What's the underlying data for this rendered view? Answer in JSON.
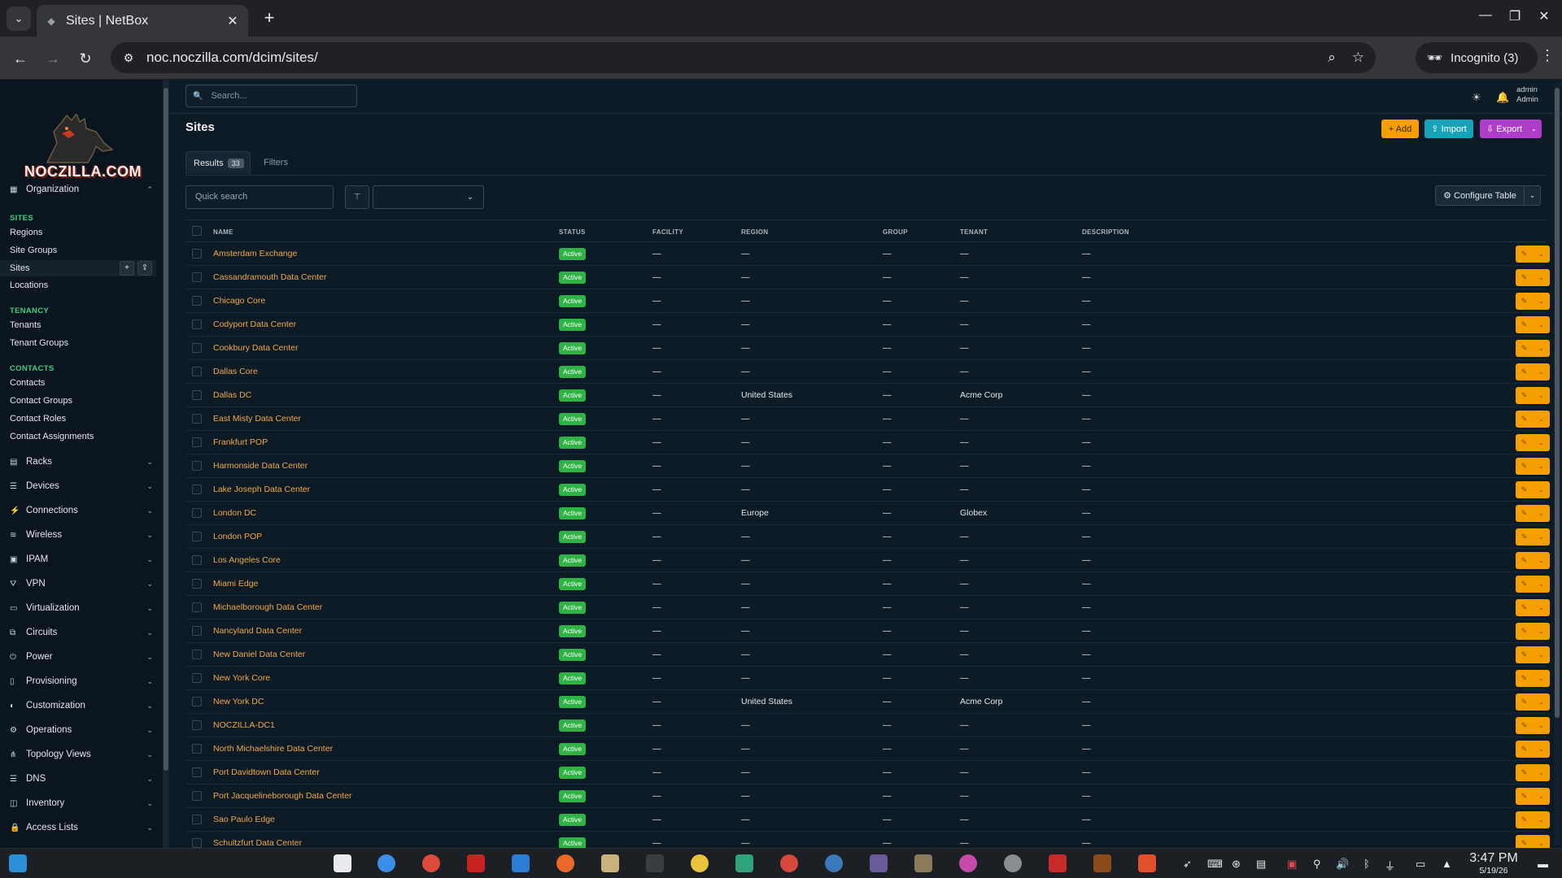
{
  "browser": {
    "tab_title": "Sites | NetBox",
    "url": "noc.noczilla.com/dcim/sites/",
    "incognito_label": "Incognito (3)"
  },
  "logo_text": "NOCZILLA.COM",
  "sidebar": {
    "organization": "Organization",
    "sections": {
      "sites": "SITES",
      "tenancy": "TENANCY",
      "contacts": "CONTACTS"
    },
    "site_items": [
      "Regions",
      "Site Groups",
      "Sites",
      "Locations"
    ],
    "tenancy_items": [
      "Tenants",
      "Tenant Groups"
    ],
    "contact_items": [
      "Contacts",
      "Contact Groups",
      "Contact Roles",
      "Contact Assignments"
    ],
    "menus": [
      "Racks",
      "Devices",
      "Connections",
      "Wireless",
      "IPAM",
      "VPN",
      "Virtualization",
      "Circuits",
      "Power",
      "Provisioning",
      "Customization",
      "Operations",
      "Topology Views",
      "DNS",
      "Inventory",
      "Access Lists"
    ]
  },
  "header": {
    "search_placeholder": "Search...",
    "user_name": "admin",
    "user_role": "Admin"
  },
  "page": {
    "title": "Sites",
    "add_label": "+ Add",
    "import_label": "⇪ Import",
    "export_label": "⇩ Export",
    "tab_results": "Results",
    "results_count": "33",
    "tab_filters": "Filters",
    "quick_search_placeholder": "Quick search",
    "configure_table": "⚙ Configure Table"
  },
  "table": {
    "columns": [
      "NAME",
      "STATUS",
      "FACILITY",
      "REGION",
      "GROUP",
      "TENANT",
      "DESCRIPTION"
    ],
    "rows": [
      {
        "name": "Amsterdam Exchange",
        "status": "Active",
        "facility": "—",
        "region": "—",
        "group": "—",
        "tenant": "—",
        "description": "—"
      },
      {
        "name": "Cassandramouth Data Center",
        "status": "Active",
        "facility": "—",
        "region": "—",
        "group": "—",
        "tenant": "—",
        "description": "—"
      },
      {
        "name": "Chicago Core",
        "status": "Active",
        "facility": "—",
        "region": "—",
        "group": "—",
        "tenant": "—",
        "description": "—"
      },
      {
        "name": "Codyport Data Center",
        "status": "Active",
        "facility": "—",
        "region": "—",
        "group": "—",
        "tenant": "—",
        "description": "—"
      },
      {
        "name": "Cookbury Data Center",
        "status": "Active",
        "facility": "—",
        "region": "—",
        "group": "—",
        "tenant": "—",
        "description": "—"
      },
      {
        "name": "Dallas Core",
        "status": "Active",
        "facility": "—",
        "region": "—",
        "group": "—",
        "tenant": "—",
        "description": "—"
      },
      {
        "name": "Dallas DC",
        "status": "Active",
        "facility": "—",
        "region": "United States",
        "group": "—",
        "tenant": "Acme Corp",
        "description": "—"
      },
      {
        "name": "East Misty Data Center",
        "status": "Active",
        "facility": "—",
        "region": "—",
        "group": "—",
        "tenant": "—",
        "description": "—"
      },
      {
        "name": "Frankfurt POP",
        "status": "Active",
        "facility": "—",
        "region": "—",
        "group": "—",
        "tenant": "—",
        "description": "—"
      },
      {
        "name": "Harmonside Data Center",
        "status": "Active",
        "facility": "—",
        "region": "—",
        "group": "—",
        "tenant": "—",
        "description": "—"
      },
      {
        "name": "Lake Joseph Data Center",
        "status": "Active",
        "facility": "—",
        "region": "—",
        "group": "—",
        "tenant": "—",
        "description": "—"
      },
      {
        "name": "London DC",
        "status": "Active",
        "facility": "—",
        "region": "Europe",
        "group": "—",
        "tenant": "Globex",
        "description": "—"
      },
      {
        "name": "London POP",
        "status": "Active",
        "facility": "—",
        "region": "—",
        "group": "—",
        "tenant": "—",
        "description": "—"
      },
      {
        "name": "Los Angeles Core",
        "status": "Active",
        "facility": "—",
        "region": "—",
        "group": "—",
        "tenant": "—",
        "description": "—"
      },
      {
        "name": "Miami Edge",
        "status": "Active",
        "facility": "—",
        "region": "—",
        "group": "—",
        "tenant": "—",
        "description": "—"
      },
      {
        "name": "Michaelborough Data Center",
        "status": "Active",
        "facility": "—",
        "region": "—",
        "group": "—",
        "tenant": "—",
        "description": "—"
      },
      {
        "name": "Nancyland Data Center",
        "status": "Active",
        "facility": "—",
        "region": "—",
        "group": "—",
        "tenant": "—",
        "description": "—"
      },
      {
        "name": "New Daniel Data Center",
        "status": "Active",
        "facility": "—",
        "region": "—",
        "group": "—",
        "tenant": "—",
        "description": "—"
      },
      {
        "name": "New York Core",
        "status": "Active",
        "facility": "—",
        "region": "—",
        "group": "—",
        "tenant": "—",
        "description": "—"
      },
      {
        "name": "New York DC",
        "status": "Active",
        "facility": "—",
        "region": "United States",
        "group": "—",
        "tenant": "Acme Corp",
        "description": "—"
      },
      {
        "name": "NOCZILLA-DC1",
        "status": "Active",
        "facility": "—",
        "region": "—",
        "group": "—",
        "tenant": "—",
        "description": "—"
      },
      {
        "name": "North Michaelshire Data Center",
        "status": "Active",
        "facility": "—",
        "region": "—",
        "group": "—",
        "tenant": "—",
        "description": "—"
      },
      {
        "name": "Port Davidtown Data Center",
        "status": "Active",
        "facility": "—",
        "region": "—",
        "group": "—",
        "tenant": "—",
        "description": "—"
      },
      {
        "name": "Port Jacquelineborough Data Center",
        "status": "Active",
        "facility": "—",
        "region": "—",
        "group": "—",
        "tenant": "—",
        "description": "—"
      },
      {
        "name": "Sao Paulo Edge",
        "status": "Active",
        "facility": "—",
        "region": "—",
        "group": "—",
        "tenant": "—",
        "description": "—"
      },
      {
        "name": "Schultzfurt Data Center",
        "status": "Active",
        "facility": "—",
        "region": "—",
        "group": "—",
        "tenant": "—",
        "description": "—"
      }
    ]
  },
  "taskbar": {
    "time": "3:47 PM",
    "date": "5/19/26"
  },
  "colors": {
    "accent_green": "#2fb344",
    "link_orange": "#f0a84a",
    "add_button": "#f59f00",
    "import_button": "#17a2b8",
    "export_button": "#ae3ec9"
  }
}
